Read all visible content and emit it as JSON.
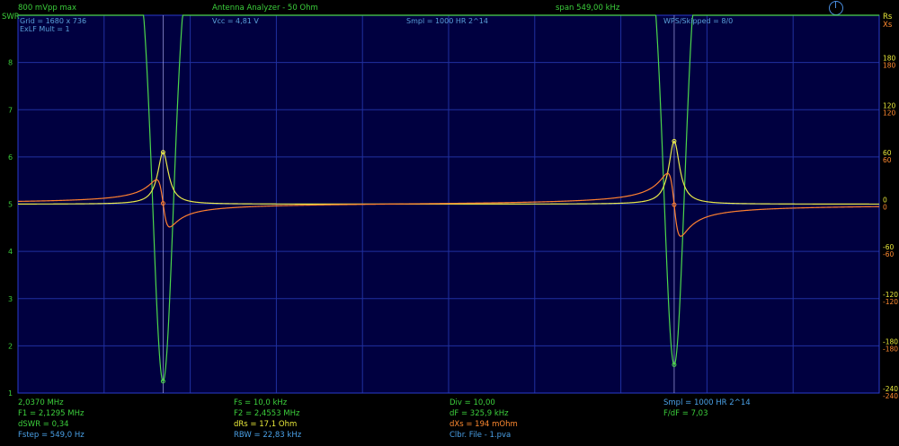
{
  "header": {
    "mvpp": "800 mVpp max",
    "title": "Antenna Analyzer - 50 Ohm",
    "span": "span 549,00 kHz"
  },
  "info": {
    "grid": "Grid = 1680 x 736",
    "exlf": "ExLF Mult = 1",
    "vcc": "Vcc = 4,81 V",
    "smpl": "Smpl = 1000 HR 2^14",
    "wps": "WPS/Skipped = 8/0"
  },
  "axes": {
    "left_title": "SWR",
    "right_title_rs": "Rs",
    "right_title_xs": "Xs"
  },
  "readout": {
    "freq": "2,0370 MHz",
    "f1": "F1 = 2,1295 MHz",
    "dswr": "dSWR = 0,34",
    "fstep": "Fstep = 549,0 Hz",
    "fs": "Fs = 10,0 kHz",
    "f2": "F2 = 2,4553 MHz",
    "drs": "dRs = 17,1 Ohm",
    "rbw": "RBW = 22,83 kHz",
    "div": "Div = 10,00",
    "df": "dF = 325,9 kHz",
    "dxs": "dXs = 194 mOhm",
    "clbr": "Clbr. File - 1.pva",
    "smpl2": "Smpl = 1000 HR  2^14",
    "fdf": "F/dF = 7,03"
  },
  "colors": {
    "swr": "#4cd64c",
    "rs": "#e8e84a",
    "xs": "#ff8030",
    "grid": "#2030a0",
    "plot_bg": "#000040"
  },
  "chart_data": {
    "type": "line",
    "x_range_mhz": [
      2.037,
      2.586
    ],
    "ylabel_left": "SWR",
    "y_left_range": [
      1,
      9
    ],
    "y_left_ticks": [
      "1",
      "2",
      "3",
      "4",
      "5",
      "6",
      "7",
      "8"
    ],
    "y_right_ticks_rs": [
      "180",
      "120",
      "60",
      "0",
      "-60",
      "-120",
      "-180",
      "-240"
    ],
    "y_right_ticks_xs": [
      "180",
      "120",
      "60",
      "0",
      "-60",
      "-120",
      "-180",
      "-240"
    ],
    "y_right_range": [
      -240,
      240
    ],
    "cursors_mhz": [
      2.1295,
      2.4553
    ],
    "resonances": [
      {
        "f": 2.1295,
        "swr_min": 1.25,
        "rs_peak": 66,
        "xs_max": 30,
        "xs_min": -30
      },
      {
        "f": 2.4553,
        "swr_min": 1.6,
        "rs_peak": 80,
        "xs_max": 40,
        "xs_min": -40
      }
    ],
    "series": [
      {
        "name": "SWR",
        "color": "#4cd64c"
      },
      {
        "name": "Rs",
        "color": "#e8e84a"
      },
      {
        "name": "Xs",
        "color": "#ff8030"
      }
    ]
  }
}
